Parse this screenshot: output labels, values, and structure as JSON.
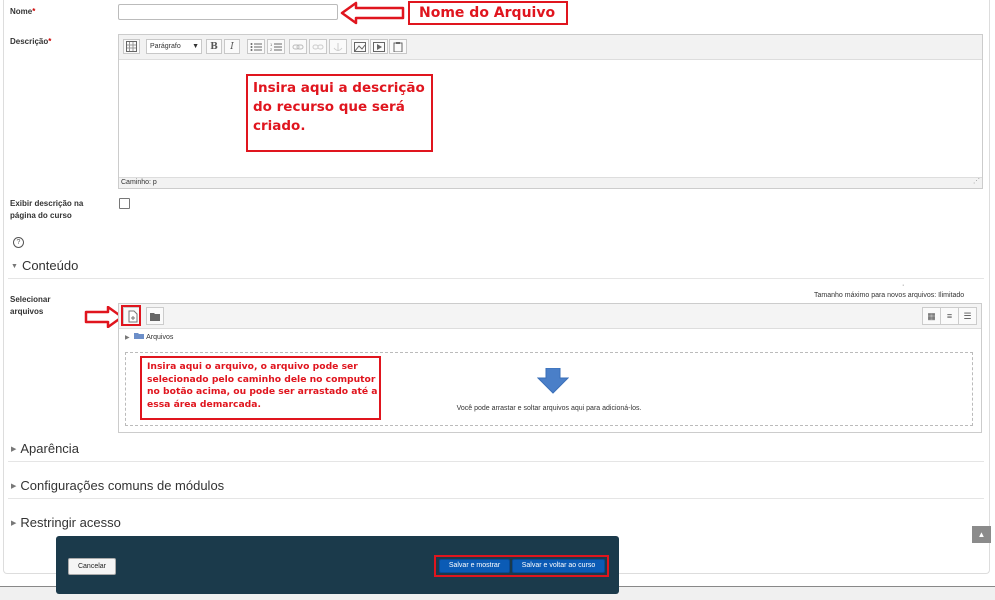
{
  "form": {
    "name_label": "Nome",
    "required_mark": "*",
    "name_value": "",
    "description_label": "Descrição",
    "show_description_label": "Exibir descrição na página do curso",
    "help_icon": "question-circle-icon"
  },
  "editor": {
    "format_select": "Parágrafo",
    "bold": "B",
    "italic": "I",
    "path": "Caminho: p"
  },
  "annotations": {
    "name_note": "Nome do Arquivo",
    "description_note": "Insira aqui a descrição do recurso que será criado.",
    "file_note": "Insira aqui o arquivo, o arquivo pode ser selecionado pelo caminho dele no computor no botão acima, ou pode ser arrastado até a essa área demarcada.",
    "color": "#e0151e"
  },
  "sections": {
    "content": "Conteúdo",
    "appearance": "Aparência",
    "common_settings": "Configurações comuns de módulos",
    "restrict_access": "Restringir acesso"
  },
  "files": {
    "select_label": "Selecionar arquivos",
    "max_size": "Tamanho máximo para novos arquivos: Ilimitado",
    "folder_name": "Arquivos",
    "drop_text": "Você pode arrastar e soltar arquivos aqui para adicioná-los."
  },
  "footer": {
    "cancel": "Cancelar",
    "save_show": "Salvar e mostrar",
    "save_return": "Salvar e voltar ao curso"
  },
  "colors": {
    "footer_bg": "#1b3a4b",
    "primary_button": "#0b5bb5",
    "drop_arrow": "#4a7fc8"
  }
}
